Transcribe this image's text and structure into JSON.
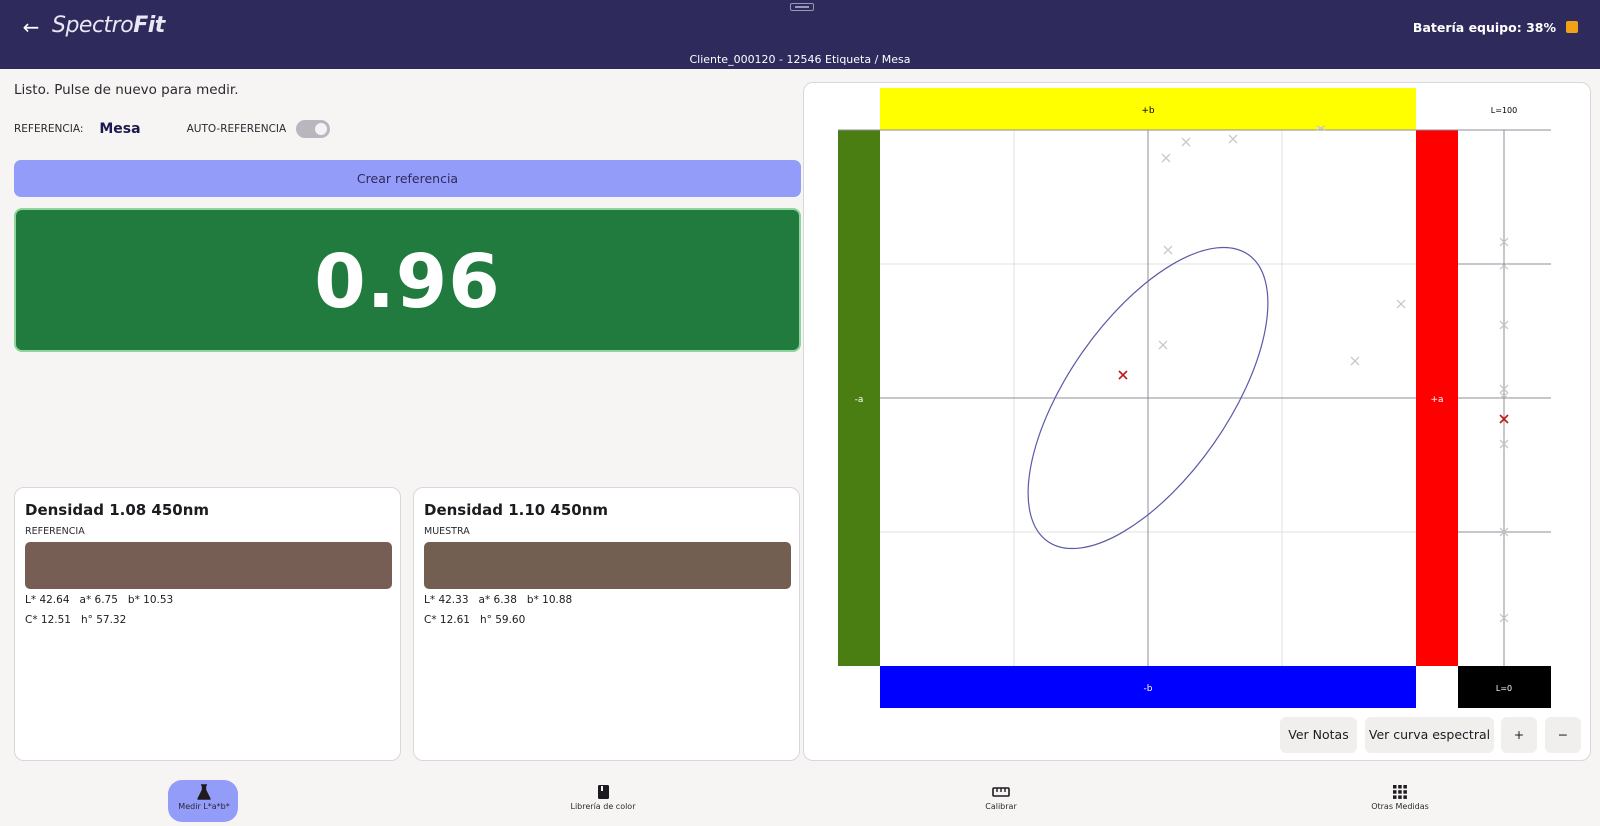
{
  "header": {
    "back_icon": "arrow-left-icon",
    "logo_part1": "Spectro",
    "logo_part2": "Fit",
    "subtitle": "Cliente_000120 - 12546 Etiqueta / Mesa",
    "battery_label": "Batería equipo: 38%",
    "battery_color": "#f1a118"
  },
  "status": {
    "message": "Listo. Pulse de nuevo para medir."
  },
  "reference": {
    "label": "REFERENCIA:",
    "value": "Mesa",
    "auto_label": "AUTO-REFERENCIA",
    "auto_enabled": true
  },
  "create_button": "Crear referencia",
  "delta": {
    "value": "0.96",
    "bg_color": "#217b3f"
  },
  "cards": {
    "reference": {
      "density": "Densidad 1.08 450nm",
      "kind": "REFERENCIA",
      "swatch_color": "#765e54",
      "lab_line": "L* 42.64   a* 6.75   b* 10.53",
      "lch_line": "C* 12.51   h° 57.32"
    },
    "sample": {
      "density": "Densidad 1.10 450nm",
      "kind": "MUESTRA",
      "swatch_color": "#735e52",
      "lab_line": "L* 42.33   a* 6.38   b* 10.88",
      "lch_line": "C* 12.61   h° 59.60"
    }
  },
  "chart": {
    "labels": {
      "plus_b": "+b",
      "minus_b": "-b",
      "plus_a": "+a",
      "minus_a": "-a",
      "l100": "L=100",
      "l0": "L=0"
    },
    "colors": {
      "plus_b": "#ffff00",
      "minus_b": "#0000ff",
      "plus_a": "#ff0000",
      "minus_a": "#4a7d12",
      "l0": "#000000",
      "ellipse": "#5a5aa8",
      "current_marker": "#c01818",
      "history_marker": "#c9c9c9"
    },
    "buttons": {
      "notes": "Ver Notas",
      "spectral": "Ver curva espectral",
      "zoom_in": "+",
      "zoom_out": "−"
    }
  },
  "nav": {
    "items": [
      {
        "label": "Medir L*a*b*",
        "icon": "flask-icon",
        "active": true
      },
      {
        "label": "Librería de color",
        "icon": "book-icon",
        "active": false
      },
      {
        "label": "Calibrar",
        "icon": "ruler-icon",
        "active": false
      },
      {
        "label": "Otras Medidas",
        "icon": "grid-icon",
        "active": false
      }
    ]
  }
}
